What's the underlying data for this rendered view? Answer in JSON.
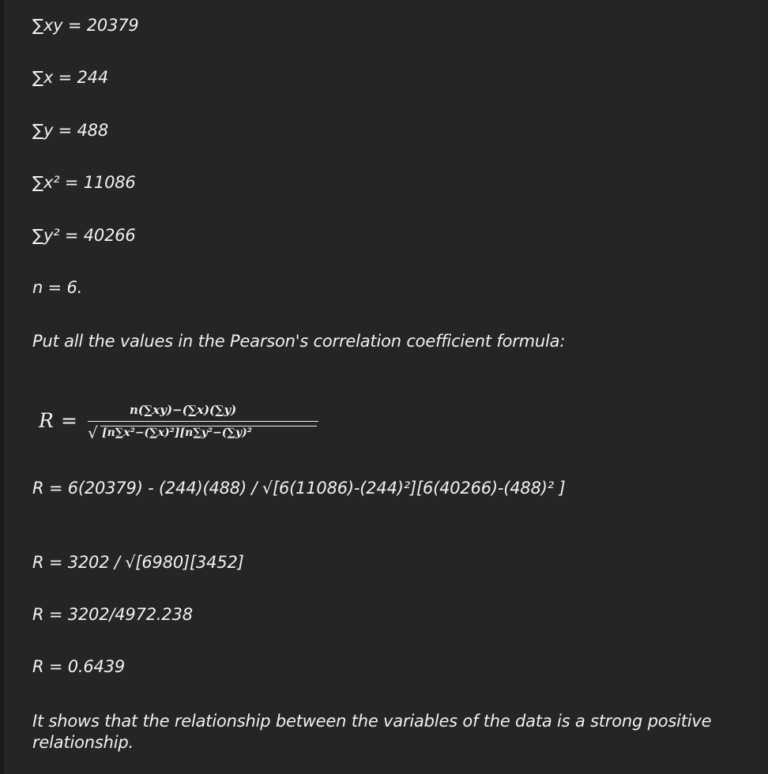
{
  "lines": {
    "sum_xy": "∑xy = 20379",
    "sum_x": "∑x = 244",
    "sum_y": "∑y = 488",
    "sum_x2": "∑x² = 11086",
    "sum_y2": "∑y² = 40266",
    "n": "n = 6.",
    "instruction": "Put all the values in the Pearson's correlation coefficient formula:",
    "step1": "R = 6(20379) - (244)(488) / √[6(11086)-(244)²][6(40266)-(488)² ]",
    "step2": "R = 3202 / √[6980][3452]",
    "step3": "R = 3202/4972.238",
    "step4": "R = 0.6439",
    "conclusion": "It shows that the relationship between the variables of the data is a strong positive relationship."
  },
  "formula": {
    "lhs": "R",
    "equals": "=",
    "numerator": "n(∑xy)−(∑x)(∑y)",
    "radical": "√",
    "denominator": "[n∑x²−(∑x)²][n∑y²−(∑y)²"
  }
}
